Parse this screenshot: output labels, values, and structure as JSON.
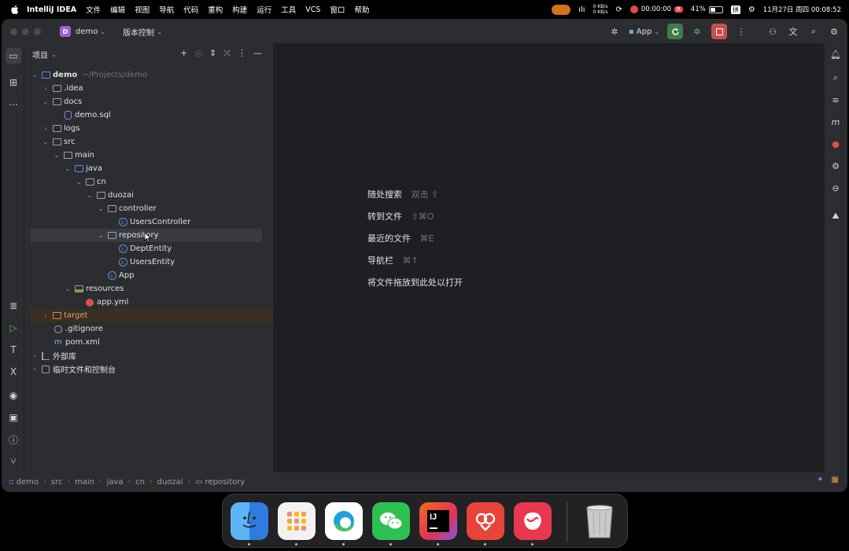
{
  "menubar": {
    "app_name": "IntelliJ IDEA",
    "items": [
      "文件",
      "编辑",
      "视图",
      "导航",
      "代码",
      "重构",
      "构建",
      "运行",
      "工具",
      "VCS",
      "窗口",
      "帮助"
    ],
    "net_up": "0 KB/s",
    "net_down": "0 KB/s",
    "record_time": "00:00:00",
    "record_badge": "R",
    "battery": "41%",
    "datetime": "11月27日 周四 00:08:52"
  },
  "titlebar": {
    "project_letter": "D",
    "project_name": "demo",
    "vcs_label": "版本控制",
    "run_config": "App"
  },
  "project_panel": {
    "title": "项目",
    "tree": [
      {
        "label": "demo",
        "hint": "~/Projects/demo",
        "bold": true
      },
      {
        "label": ".idea"
      },
      {
        "label": "docs"
      },
      {
        "label": "demo.sql"
      },
      {
        "label": "logs"
      },
      {
        "label": "src"
      },
      {
        "label": "main"
      },
      {
        "label": "java"
      },
      {
        "label": "cn"
      },
      {
        "label": "duozai"
      },
      {
        "label": "controller"
      },
      {
        "label": "UsersController"
      },
      {
        "label": "repository"
      },
      {
        "label": "DeptEntity"
      },
      {
        "label": "UsersEntity"
      },
      {
        "label": "App"
      },
      {
        "label": "resources"
      },
      {
        "label": "app.yml"
      },
      {
        "label": "target"
      },
      {
        "label": ".gitignore"
      },
      {
        "label": "pom.xml"
      },
      {
        "label": "外部库"
      },
      {
        "label": "临时文件和控制台"
      }
    ]
  },
  "editor_hints": [
    {
      "label": "随处搜索",
      "shortcut": "双击 ⇧"
    },
    {
      "label": "转到文件",
      "shortcut": "⇧⌘O"
    },
    {
      "label": "最近的文件",
      "shortcut": "⌘E"
    },
    {
      "label": "导航栏",
      "shortcut": "⌘↑"
    },
    {
      "label": "将文件拖放到此处以打开",
      "shortcut": ""
    }
  ],
  "breadcrumb": [
    "demo",
    "src",
    "main",
    "java",
    "cn",
    "duozai",
    "repository"
  ],
  "dock": {
    "apps": [
      "Finder",
      "Launchpad",
      "Edge",
      "WeChat",
      "IntelliJ IDEA",
      "App",
      "App",
      "Trash"
    ],
    "colors": {
      "finder": "#2f7be0",
      "launchpad": "#f2f2f2",
      "edge": "#ffffff",
      "wechat": "#2dc152",
      "intellij": "#f26b21",
      "app6": "#e8443a",
      "app7": "#e8384f"
    }
  }
}
